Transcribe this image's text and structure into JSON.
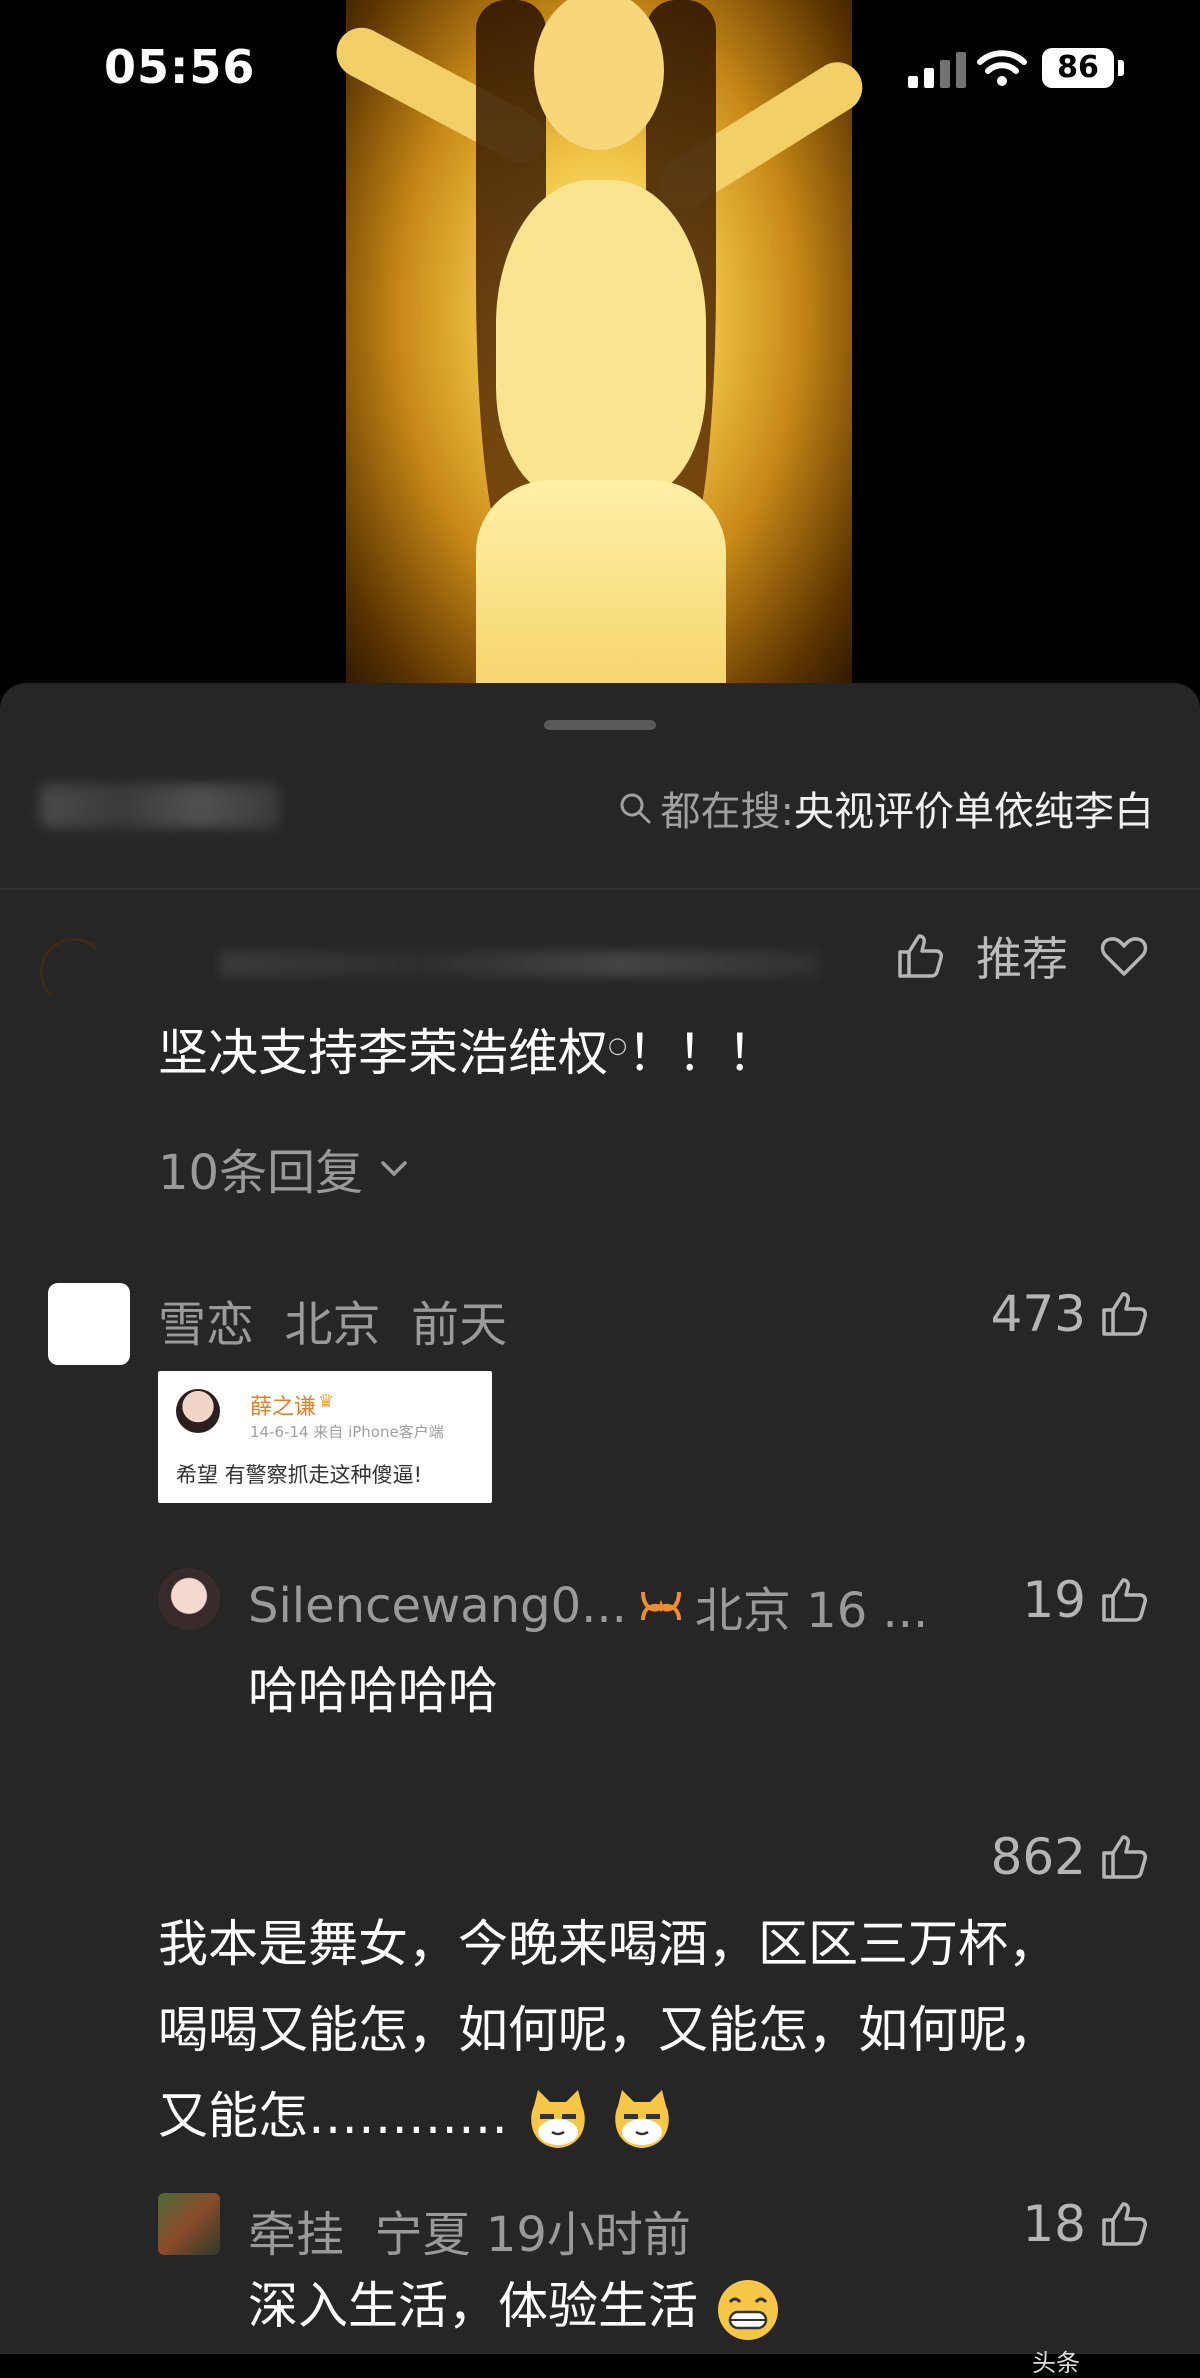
{
  "status_bar": {
    "time": "05:56",
    "battery": "86"
  },
  "hot_search": {
    "prefix": "都在搜:",
    "query": "央视评价单依纯李白"
  },
  "top_comment": {
    "recommend_label": "推荐",
    "text": "坚决支持李荣浩维权",
    "text_suffix": "！！！",
    "replies_label": "10条回复"
  },
  "comments": [
    {
      "username": "雪恋",
      "location": "北京",
      "time": "前天",
      "likes": "473",
      "embed": {
        "name": "薛之谦",
        "date": "14-6-14  来自 iPhone客户端",
        "text": "希望 有警察抓走这种傻逼!"
      }
    },
    {
      "username": "Silencewang0...",
      "location": "北京 16 ...",
      "likes": "19",
      "text": "哈哈哈哈哈"
    },
    {
      "likes": "862",
      "lines": [
        "我本是舞女，今晚来喝酒，区区三万杯，",
        "喝喝又能怎，如何呢，又能怎，如何呢，",
        "又能怎…………"
      ]
    },
    {
      "username": "牵挂",
      "location": "宁夏",
      "time": "19小时前",
      "likes": "18",
      "text": "深入生活，体验生活"
    }
  ],
  "watermark": "头条"
}
